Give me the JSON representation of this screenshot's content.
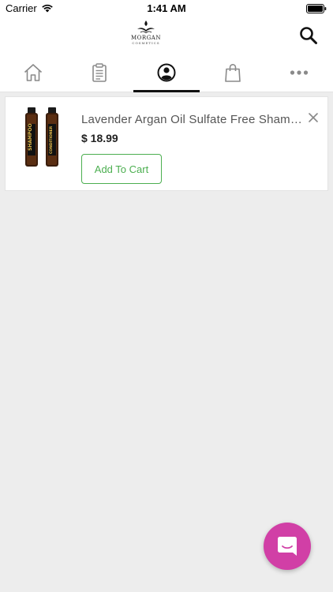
{
  "status_bar": {
    "carrier": "Carrier",
    "time": "1:41 AM"
  },
  "header": {
    "logo_text": "MORGAN",
    "logo_subtext": "COSMETICS"
  },
  "tabs": [
    {
      "icon": "home-icon"
    },
    {
      "icon": "clipboard-icon"
    },
    {
      "icon": "profile-icon",
      "active": true
    },
    {
      "icon": "shopping-bag-icon"
    },
    {
      "icon": "more-icon"
    }
  ],
  "wishlist_item": {
    "name": "Lavender Argan Oil Sulfate Free Shampoo and Conditioner Set",
    "price": "$ 18.99",
    "add_to_cart_label": "Add To Cart",
    "image_labels": [
      "SHAMPOO",
      "CONDITIONER"
    ]
  },
  "colors": {
    "accent_green": "#4caf50",
    "chat_button": "#d13fa6",
    "active_tab_underline": "#111111"
  }
}
